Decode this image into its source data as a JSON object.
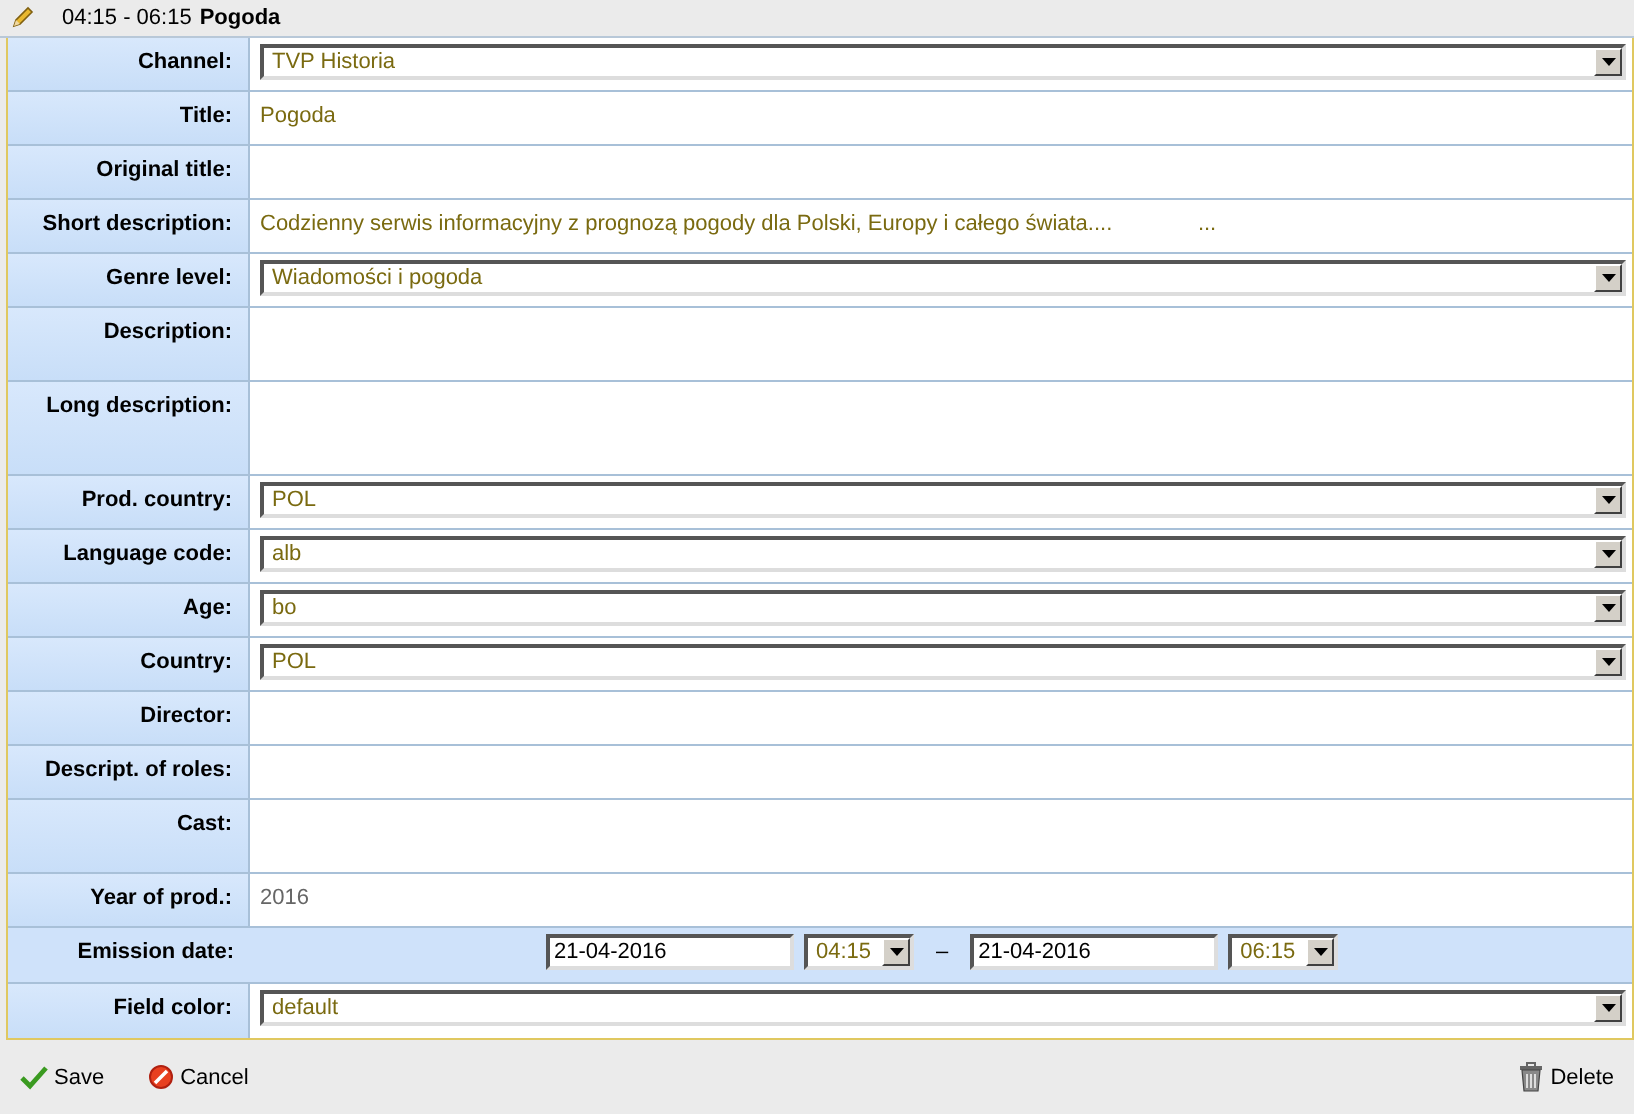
{
  "header": {
    "time": "04:15 - 06:15",
    "title": "Pogoda"
  },
  "rows": [
    {
      "kind": "select",
      "label": "Channel:",
      "value": "TVP Historia"
    },
    {
      "kind": "text",
      "label": "Title:",
      "value": "Pogoda"
    },
    {
      "kind": "text",
      "label": "Original title:"
    },
    {
      "kind": "text",
      "label": "Short description:",
      "value": "Codzienny serwis informacyjny z prognozą pogody dla Polski, Europy i całego świata....              ..."
    },
    {
      "kind": "select",
      "label": "Genre level:",
      "value": "Wiadomości i pogoda"
    },
    {
      "kind": "area",
      "label": "Description:"
    },
    {
      "kind": "bigarea",
      "label": "Long description:"
    },
    {
      "kind": "select",
      "label": "Prod. country:",
      "value": "POL"
    },
    {
      "kind": "select",
      "label": "Language code:",
      "value": "alb"
    },
    {
      "kind": "select",
      "label": "Age:",
      "value": "bo"
    },
    {
      "kind": "select",
      "label": "Country:",
      "value": "POL"
    },
    {
      "kind": "text",
      "label": "Director:"
    },
    {
      "kind": "text",
      "label": "Descript. of roles:"
    },
    {
      "kind": "area",
      "label": "Cast:"
    },
    {
      "kind": "readonly",
      "label": "Year of prod.:",
      "value": "2016"
    },
    {
      "kind": "emission",
      "label": "Emission date:",
      "start_date": "21-04-2016",
      "start_time": "04:15",
      "separator": "–",
      "end_date": "21-04-2016",
      "end_time": "06:15"
    },
    {
      "kind": "select",
      "label": "Field color:",
      "value": "default"
    }
  ],
  "footer": {
    "save": "Save",
    "cancel": "Cancel",
    "delete": "Delete"
  }
}
